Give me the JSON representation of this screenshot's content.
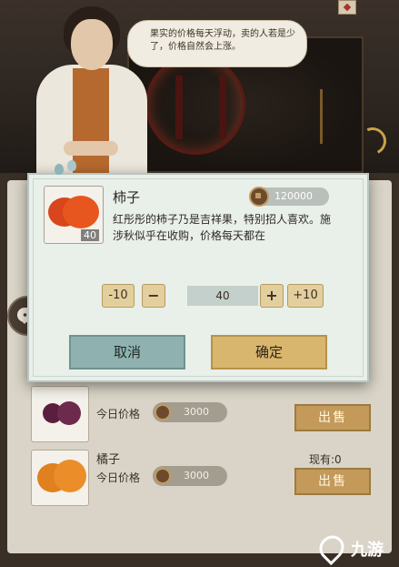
{
  "npc": {
    "dialogue": "果实的价格每天浮动，卖的人若是少了，价格自然会上涨。"
  },
  "market": {
    "goods": [
      {
        "name": "",
        "price_label": "今日价格",
        "price": "3000",
        "stock": "",
        "sell_label": "出售"
      },
      {
        "name": "橘子",
        "price_label": "今日价格",
        "price": "3000",
        "stock": "现有:0",
        "sell_label": "出售"
      }
    ]
  },
  "dialog": {
    "item_name": "柿子",
    "price": "120000",
    "quantity_badge": "40",
    "description": "红彤彤的柿子乃是吉祥果，特别招人喜欢。施涉秋似乎在收购，价格每天都在",
    "quantity": {
      "minus10_label": "-10",
      "minus_label": "−",
      "value": "40",
      "plus_label": "+",
      "plus10_label": "+10"
    },
    "cancel_label": "取消",
    "confirm_label": "确定"
  },
  "watermark": {
    "text": "九游"
  },
  "colors": {
    "modal_bg": "#e9efe9",
    "cancel": "#8fb2b0",
    "confirm": "#d9b66e",
    "qty_button": "#e3cf9d"
  },
  "icons": [
    "coin-icon",
    "chat-bubble-icon",
    "persimmon-icon",
    "plum-icon",
    "orange-icon",
    "bird-icon",
    "jiuyou-logo-icon"
  ]
}
